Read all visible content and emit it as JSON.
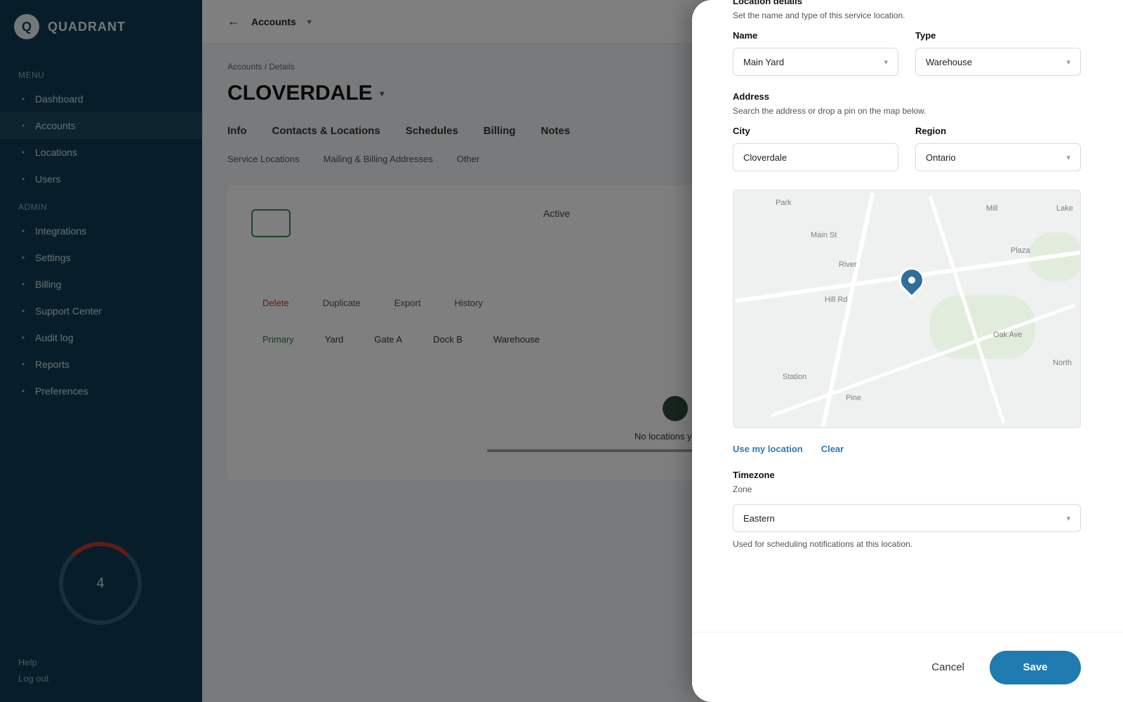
{
  "brand": {
    "name": "QUADRANT",
    "logo_letter": "Q"
  },
  "sidebar": {
    "sections": [
      {
        "title": "Menu",
        "items": [
          "Dashboard",
          "Accounts",
          "Locations",
          "Users"
        ]
      },
      {
        "title": "Admin",
        "items": [
          "Integrations",
          "Settings",
          "Billing",
          "Support Center",
          "Audit log",
          "Reports",
          "Preferences"
        ]
      }
    ],
    "gauge_value": "4",
    "footer": [
      "Help",
      "Log out"
    ]
  },
  "main": {
    "topbar": {
      "crumb": "Accounts"
    },
    "crumbs_small": "Accounts / Details",
    "page_title": "CLOVERDALE",
    "tabs": [
      "Info",
      "Contacts & Locations",
      "Schedules",
      "Billing",
      "Notes"
    ],
    "subtabs": [
      "Service Locations",
      "Mailing & Billing Addresses",
      "Other"
    ],
    "card": {
      "pill": "Active",
      "row1": [
        "Delete",
        "Duplicate",
        "Export",
        "History"
      ],
      "row2": [
        "Primary",
        "Yard",
        "Gate A",
        "Dock B",
        "Warehouse"
      ],
      "empty_text": "No locations yet"
    }
  },
  "drawer": {
    "section1": {
      "title": "Location details",
      "desc": "Set the name and type of this service location.",
      "fields": [
        {
          "label": "Name",
          "value": "Main Yard",
          "suffix": ""
        },
        {
          "label": "Type",
          "value": "Warehouse",
          "suffix": ""
        }
      ]
    },
    "section2": {
      "title": "Address",
      "desc": "Search the address or drop a pin on the map below.",
      "fields": [
        {
          "label": "City",
          "value": "Cloverdale",
          "suffix": ""
        },
        {
          "label": "Region",
          "value": "Ontario",
          "suffix": ""
        }
      ]
    },
    "map": {
      "labels": [
        "Park",
        "Main St",
        "River",
        "Hill Rd",
        "Mill",
        "Lake",
        "Plaza",
        "Oak Ave",
        "Station",
        "Pine",
        "North"
      ]
    },
    "links": [
      "Use my location",
      "Clear"
    ],
    "section3": {
      "title": "Timezone",
      "label": "Zone",
      "value": "Eastern",
      "helper": "Used for scheduling notifications at this location."
    },
    "footer": {
      "cancel": "Cancel",
      "save": "Save"
    }
  }
}
